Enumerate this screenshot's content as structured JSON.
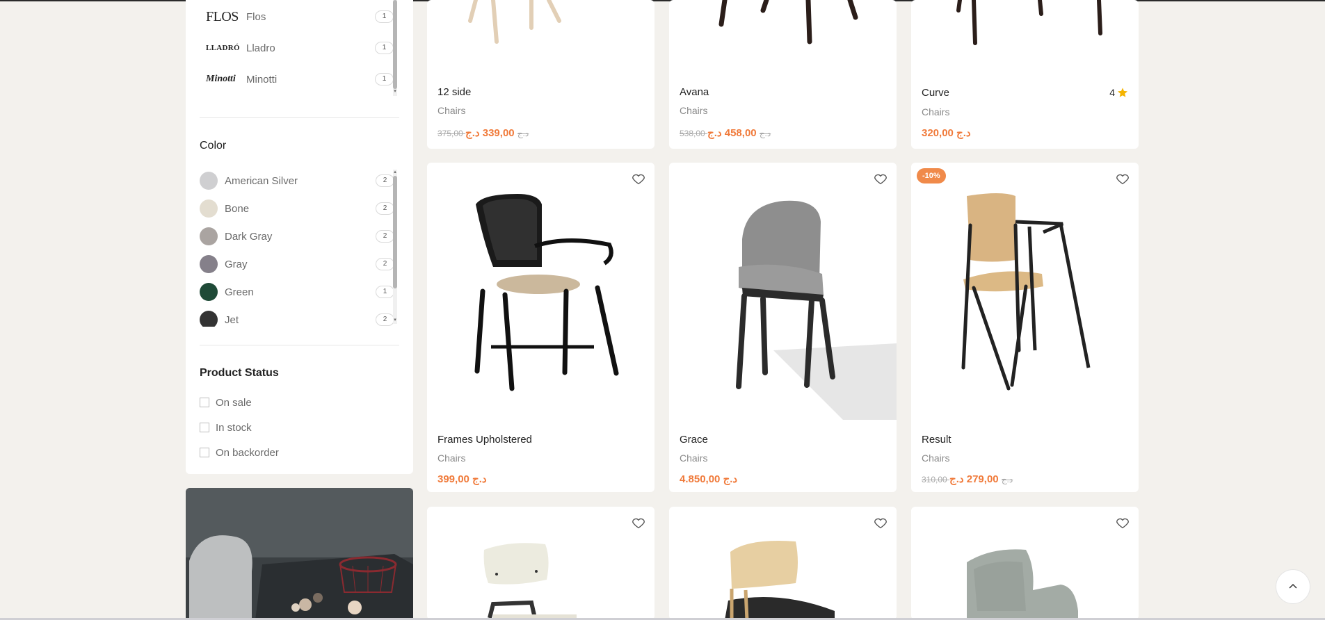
{
  "brands": [
    {
      "logo": "FLOS",
      "name": "Flos",
      "count": "1"
    },
    {
      "logo": "LLADRÓ",
      "name": "Lladro",
      "count": "1"
    },
    {
      "logo": "Minotti",
      "name": "Minotti",
      "count": "1"
    }
  ],
  "color_filter": {
    "title": "Color",
    "items": [
      {
        "name": "American Silver",
        "count": "2",
        "swatch": "#cfcfd1"
      },
      {
        "name": "Bone",
        "count": "2",
        "swatch": "#e3ddd0"
      },
      {
        "name": "Dark Gray",
        "count": "2",
        "swatch": "#aaa4a1"
      },
      {
        "name": "Gray",
        "count": "2",
        "swatch": "#85808a"
      },
      {
        "name": "Green",
        "count": "1",
        "swatch": "#1f4a37"
      },
      {
        "name": "Jet",
        "count": "2",
        "swatch": "#333333"
      }
    ]
  },
  "status_filter": {
    "title": "Product Status",
    "options": [
      "On sale",
      "In stock",
      "On backorder"
    ]
  },
  "products": [
    {
      "title": "12 side",
      "category": "Chairs",
      "old_price": "375,00 د.ج",
      "price": "339,00 د.ج"
    },
    {
      "title": "Avana",
      "category": "Chairs",
      "old_price": "538,00 د.ج",
      "price": "458,00 د.ج"
    },
    {
      "title": "Curve",
      "category": "Chairs",
      "old_price": "",
      "price": "320,00 د.ج",
      "rating": "4"
    },
    {
      "title": "Frames Upholstered",
      "category": "Chairs",
      "old_price": "",
      "price": "399,00 د.ج"
    },
    {
      "title": "Grace",
      "category": "Chairs",
      "old_price": "",
      "price": "4.850,00 د.ج"
    },
    {
      "title": "Result",
      "category": "Chairs",
      "old_price": "310,00 د.ج",
      "price": "279,00 د.ج",
      "badge": "-10%"
    }
  ],
  "colors": {
    "accent": "#f07a3a",
    "badge": "#f08a4a",
    "star": "#f5b400"
  }
}
